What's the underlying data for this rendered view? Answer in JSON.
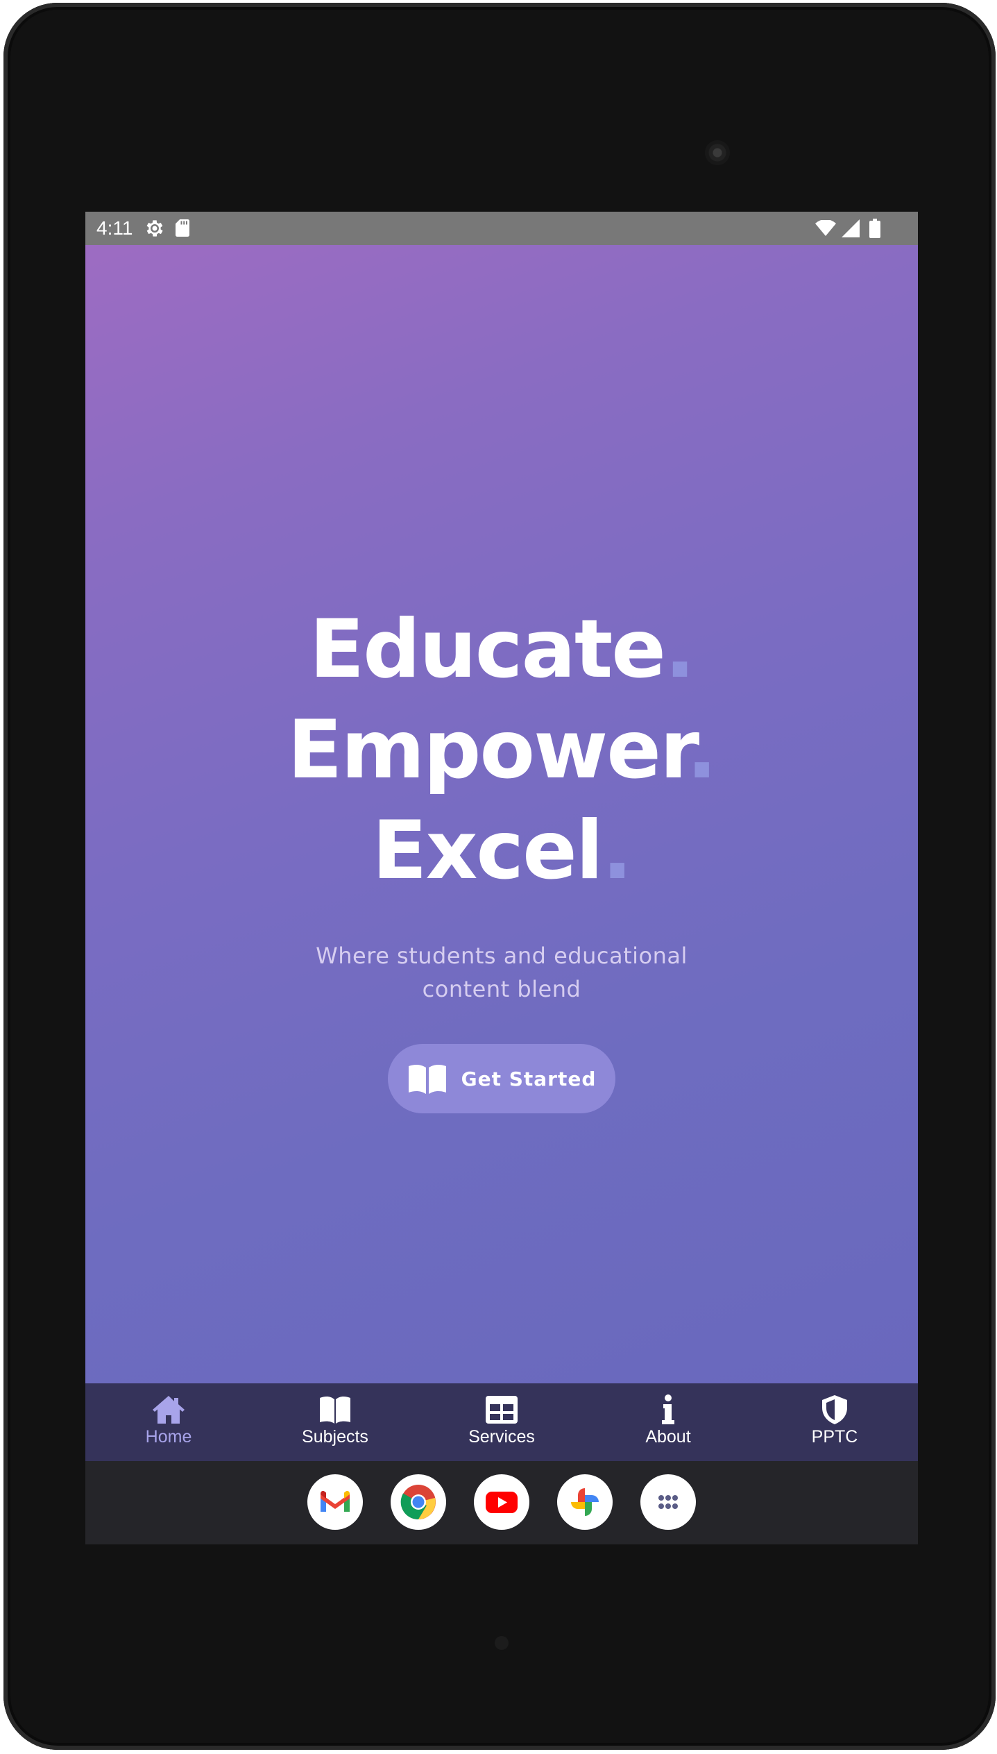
{
  "status_bar": {
    "time": "4:11",
    "icons": [
      "settings-gear-icon",
      "sd-card-icon",
      "wifi-icon",
      "cell-signal-icon",
      "battery-icon"
    ]
  },
  "hero": {
    "headline": [
      {
        "word": "Educate",
        "dot": "."
      },
      {
        "word": "Empower",
        "dot": "."
      },
      {
        "word": "Excel",
        "dot": "."
      }
    ],
    "tagline": "Where students and educational content blend",
    "cta_label": "Get Started",
    "cta_icon": "open-book-icon"
  },
  "bottom_nav": {
    "active": "Home",
    "items": [
      {
        "label": "Home",
        "icon": "home-icon"
      },
      {
        "label": "Subjects",
        "icon": "open-book-icon"
      },
      {
        "label": "Services",
        "icon": "grid-table-icon"
      },
      {
        "label": "About",
        "icon": "info-icon"
      },
      {
        "label": "PPTC",
        "icon": "shield-icon"
      }
    ]
  },
  "dock": {
    "apps": [
      "gmail-icon",
      "chrome-icon",
      "youtube-icon",
      "photos-icon",
      "app-drawer-icon"
    ]
  },
  "colors": {
    "gradient_start": "#9d6cc2",
    "gradient_end": "#6968bd",
    "nav_background": "#35335a",
    "nav_active": "#a8a4ea",
    "button": "#8e88d8",
    "accent_dot": "#8e91dd"
  }
}
